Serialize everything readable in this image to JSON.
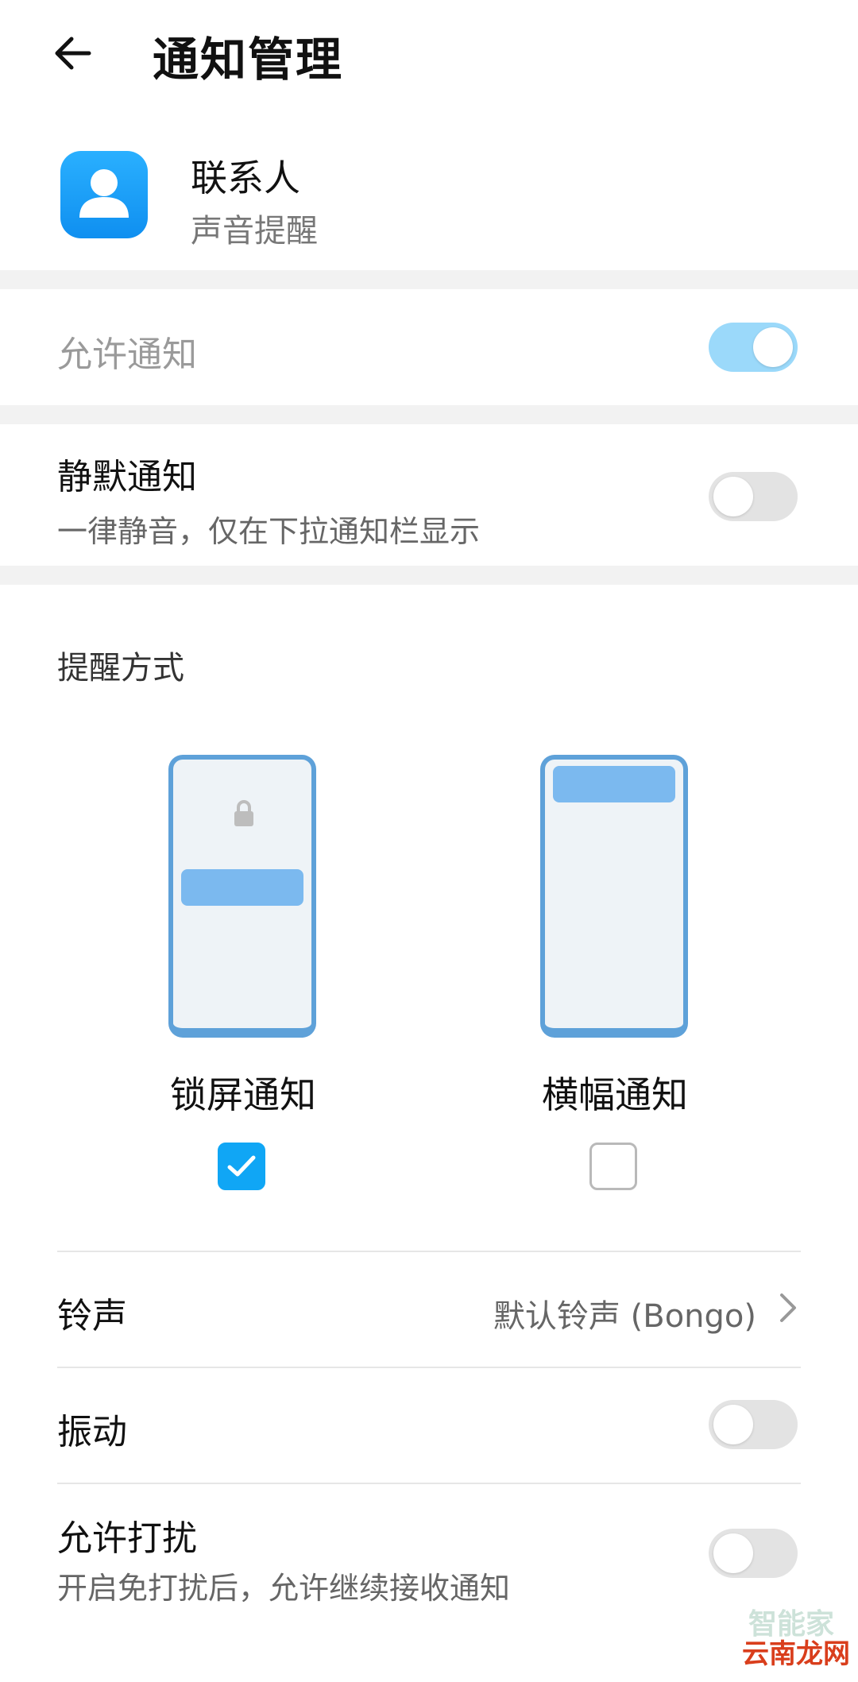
{
  "header": {
    "title": "通知管理"
  },
  "app": {
    "name": "联系人",
    "subtitle": "声音提醒"
  },
  "allow_notifications": {
    "label": "允许通知",
    "enabled": true
  },
  "silent_notifications": {
    "label": "静默通知",
    "description": "一律静音，仅在下拉通知栏显示",
    "enabled": false
  },
  "reminder": {
    "section_title": "提醒方式",
    "styles": [
      {
        "label": "锁屏通知",
        "checked": true
      },
      {
        "label": "横幅通知",
        "checked": false
      }
    ]
  },
  "ringtone": {
    "label": "铃声",
    "value": "默认铃声 (Bongo)"
  },
  "vibration": {
    "label": "振动",
    "enabled": false
  },
  "do_not_disturb": {
    "label": "允许打扰",
    "description": "开启免打扰后，允许继续接收通知",
    "enabled": false
  },
  "watermark": {
    "top": "智能家",
    "bottom": "云南龙网"
  },
  "colors": {
    "accent": "#10a6f5",
    "switch_on": "#9bd9fa",
    "switch_off": "#e3e3e3",
    "phone_border": "#5ea1d9"
  }
}
